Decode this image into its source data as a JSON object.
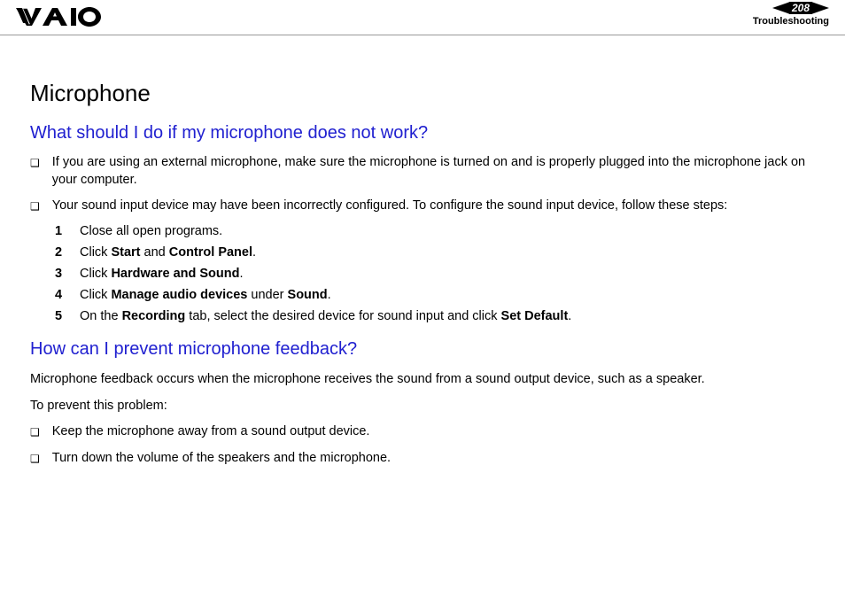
{
  "header": {
    "page_number": "208",
    "section": "Troubleshooting"
  },
  "page": {
    "title": "Microphone",
    "q1": {
      "heading": "What should I do if my microphone does not work?",
      "bullets": [
        "If you are using an external microphone, make sure the microphone is turned on and is properly plugged into the microphone jack on your computer.",
        "Your sound input device may have been incorrectly configured. To configure the sound input device, follow these steps:"
      ],
      "steps": [
        {
          "n": "1",
          "pre": "Close all open programs."
        },
        {
          "n": "2",
          "pre": "Click ",
          "b1": "Start",
          "mid": " and ",
          "b2": "Control Panel",
          "post": "."
        },
        {
          "n": "3",
          "pre": "Click ",
          "b1": "Hardware and Sound",
          "post": "."
        },
        {
          "n": "4",
          "pre": "Click ",
          "b1": "Manage audio devices",
          "mid": " under ",
          "b2": "Sound",
          "post": "."
        },
        {
          "n": "5",
          "pre": "On the ",
          "b1": "Recording",
          "mid": " tab, select the desired device for sound input and click ",
          "b2": "Set Default",
          "post": "."
        }
      ]
    },
    "q2": {
      "heading": "How can I prevent microphone feedback?",
      "intro1": "Microphone feedback occurs when the microphone receives the sound from a sound output device, such as a speaker.",
      "intro2": "To prevent this problem:",
      "bullets": [
        "Keep the microphone away from a sound output device.",
        "Turn down the volume of the speakers and the microphone."
      ]
    }
  }
}
